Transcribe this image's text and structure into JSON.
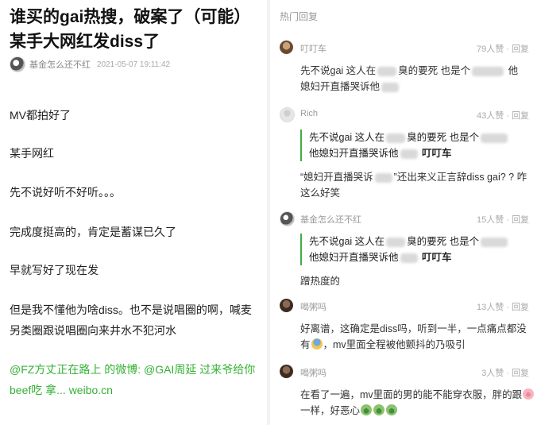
{
  "article": {
    "title_line1": "谁买的gai热搜，破案了（可能）",
    "title_line2": "某手大网红发diss了",
    "author": "基金怎么还不红",
    "time": "2021-05-07 19:11:42",
    "paragraphs": [
      "MV都拍好了",
      "某手网红",
      "先不说好听不好听。。。",
      "完成度挺高的，肯定是蓄谋已久了",
      "早就写好了现在发",
      "但是我不懂他为啥diss。也不是说唱圈的啊，喊麦另类圈跟说唱圈向来井水不犯河水"
    ],
    "link_text": "@FZ方丈正在路上 的微博: @GAI周延 过来爷给你beef吃 拿... weibo.cn"
  },
  "hot": {
    "title": "热门回复",
    "reply_label": "回复",
    "comments": [
      {
        "name": "叮叮车",
        "likes": "79人赞",
        "text_a": "先不说gai 这人在",
        "text_b": "臭的要死 也是个",
        "text_c": "他",
        "text_d": "媳妇开直播哭诉他"
      },
      {
        "name": "Rich",
        "likes": "43人赞",
        "quote_a": "先不说gai 这人在",
        "quote_b": "臭的要死 也是个",
        "quote_c": "他媳妇开直播哭诉他",
        "quote_author": "叮叮车",
        "text_a": "“媳妇开直播哭诉",
        "text_b": "”还出来义正言辞diss gai? ? 咋这么好笑"
      },
      {
        "name": "基金怎么还不红",
        "likes": "15人赞",
        "quote_a": "先不说gai 这人在",
        "quote_b": "臭的要死 也是个",
        "quote_c": "他媳妇开直播哭诉他",
        "quote_author": "叮叮车",
        "text": "蹭热度的"
      },
      {
        "name": "喝粥吗",
        "likes": "13人赞",
        "text_a": "好离谱，这确定是diss吗，听到一半，一点痛点都没有",
        "text_b": "，mv里面全程被他颤抖的乃吸引"
      },
      {
        "name": "喝粥吗",
        "likes": "3人赞",
        "text_a": "在看了一遍，mv里面的男的能不能穿衣服，胖的跟",
        "text_b": "一样，好恶心"
      }
    ]
  },
  "colors": {
    "link_green": "#34b134",
    "quote_bar": "#3fae3f"
  },
  "icons": [
    "author-avatar",
    "commenter-avatar",
    "fearful-face-emoji",
    "pig-face-emoji",
    "nauseated-face-emoji"
  ]
}
